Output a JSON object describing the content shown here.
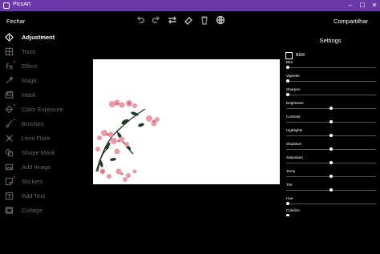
{
  "titlebar": {
    "app_title": "PicsArt",
    "minimize": "–",
    "maximize": "☐",
    "close": "✕"
  },
  "topbar": {
    "back_label": "Fechar",
    "share_label": "Compartilhar"
  },
  "toolbar": {
    "icons": [
      "undo-icon",
      "redo-icon",
      "repeat-icon",
      "eraser-icon",
      "trash-icon",
      "globe-icon"
    ]
  },
  "sidebar": {
    "items": [
      {
        "label": "Adjustment",
        "icon": "adjustment-icon",
        "active": true,
        "new": false
      },
      {
        "label": "Tools",
        "icon": "tools-icon",
        "active": false,
        "new": false
      },
      {
        "label": "Effect",
        "icon": "effect-fx-icon",
        "active": false,
        "new": true
      },
      {
        "label": "Magic",
        "icon": "magic-icon",
        "active": false,
        "new": false
      },
      {
        "label": "Mask",
        "icon": "mask-icon",
        "active": false,
        "new": false
      },
      {
        "label": "Color Exposure",
        "icon": "color-exposure-icon",
        "active": false,
        "new": true
      },
      {
        "label": "Brushes",
        "icon": "brushes-icon",
        "active": false,
        "new": true
      },
      {
        "label": "Lens Flare",
        "icon": "lens-flare-icon",
        "active": false,
        "new": false
      },
      {
        "label": "Shape Mask",
        "icon": "shape-mask-icon",
        "active": false,
        "new": false
      },
      {
        "label": "Add Image",
        "icon": "add-image-icon",
        "active": false,
        "new": false
      },
      {
        "label": "Stickers",
        "icon": "stickers-icon",
        "active": false,
        "new": true
      },
      {
        "label": "Add Text",
        "icon": "add-text-icon",
        "active": false,
        "new": false
      },
      {
        "label": "Collage",
        "icon": "collage-icon",
        "active": false,
        "new": false
      }
    ]
  },
  "settings": {
    "heading": "Settings",
    "bw_label": "B&W",
    "sliders": [
      {
        "label": "Blur",
        "value": 0.0
      },
      {
        "label": "Vignette",
        "value": 0.0
      },
      {
        "label": "Sharpen",
        "value": 0.0
      },
      {
        "label": "Brightness",
        "value": 0.5
      },
      {
        "label": "Contrast",
        "value": 0.5
      },
      {
        "label": "Highlights",
        "value": 0.5
      },
      {
        "label": "Shadows",
        "value": 0.5
      },
      {
        "label": "Saturation",
        "value": 0.5
      },
      {
        "label": "Temp",
        "value": 0.5
      },
      {
        "label": "Tint",
        "value": 0.5
      },
      {
        "label": "Hue",
        "value": 0.0
      },
      {
        "label": "Colorize",
        "value": 0.0
      }
    ]
  },
  "colors": {
    "titlebar": "#6b38a8",
    "background": "#000000",
    "new_dot": "#d0243c",
    "flower": "#e89aa6",
    "leaf": "#1f3a26"
  }
}
